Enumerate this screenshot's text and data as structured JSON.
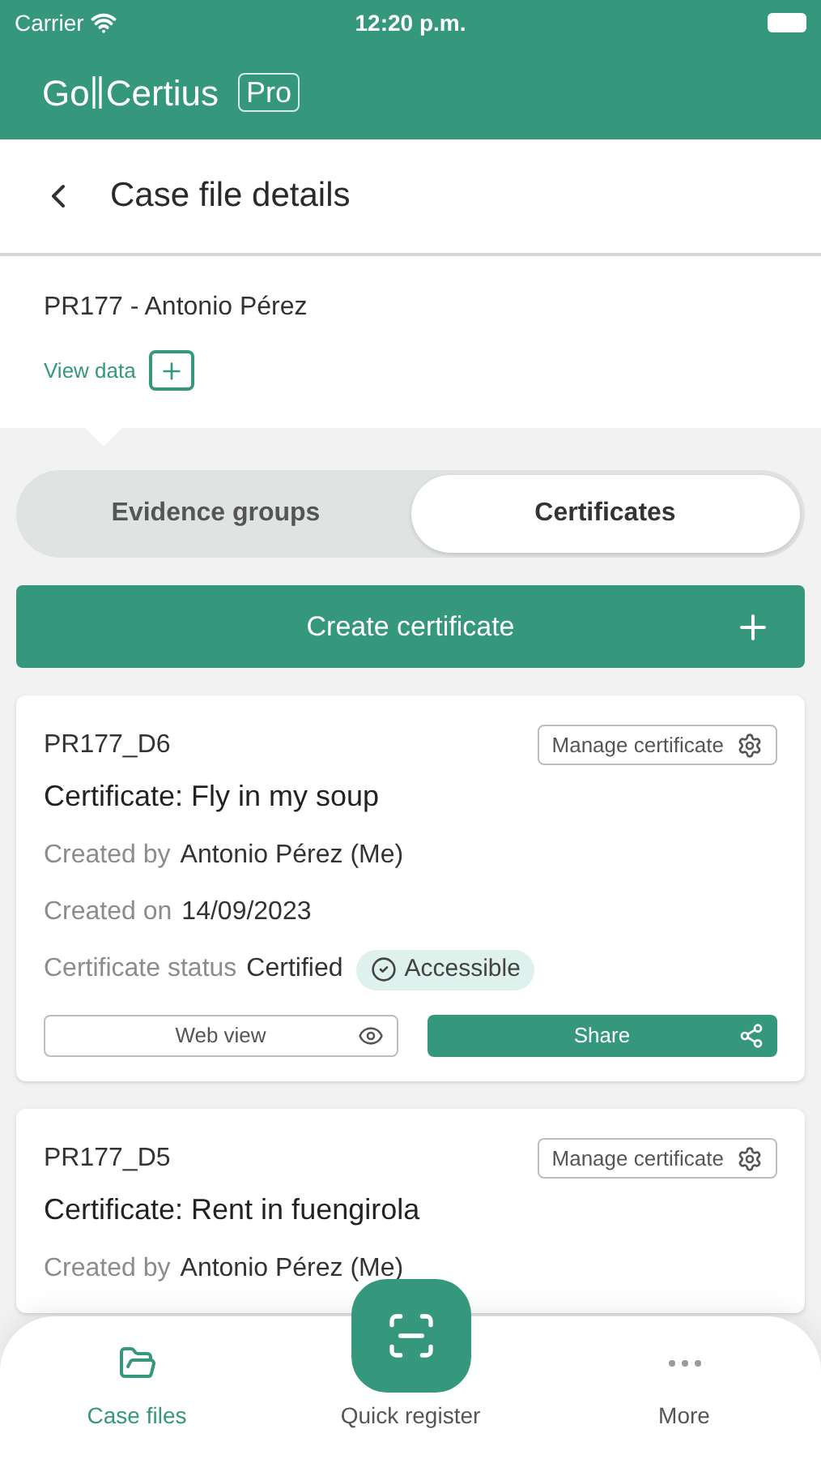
{
  "status_bar": {
    "carrier": "Carrier",
    "time": "12:20 p.m."
  },
  "app_bar": {
    "brand_left": "Go",
    "brand_right": "Certius",
    "badge": "Pro"
  },
  "page_title": "Case file details",
  "case_file": {
    "title": "PR177 - Antonio Pérez",
    "link": "View data"
  },
  "tabs": [
    {
      "label": "Evidence groups",
      "selected": false
    },
    {
      "label": "Certificates",
      "selected": true
    }
  ],
  "create_button": "Create certificate",
  "certificates": [
    {
      "code": "PR177_D6",
      "manage": "Manage certificate",
      "title": "Certificate: Fly in my soup",
      "fields": [
        {
          "label": "Created by",
          "value": "Antonio Pérez (Me)"
        },
        {
          "label": "Created on",
          "value": "14/09/2023"
        },
        {
          "label": "Certificate status",
          "value": "Certified",
          "badge": "Accessible"
        }
      ],
      "actions": [
        {
          "label": "Web view",
          "kind": "view"
        },
        {
          "label": "Share",
          "kind": "share"
        }
      ]
    },
    {
      "code": "PR177_D5",
      "manage": "Manage certificate",
      "title": "Certificate: Rent in fuengirola",
      "fields": [
        {
          "label": "Created by",
          "value": "Antonio Pérez (Me)"
        }
      ]
    }
  ],
  "bottom_nav": [
    {
      "label": "Case files",
      "kind": "folder",
      "selected": true
    },
    {
      "label": "Quick register",
      "kind": "scan",
      "selected": false
    },
    {
      "label": "More",
      "kind": "more",
      "selected": false
    }
  ]
}
